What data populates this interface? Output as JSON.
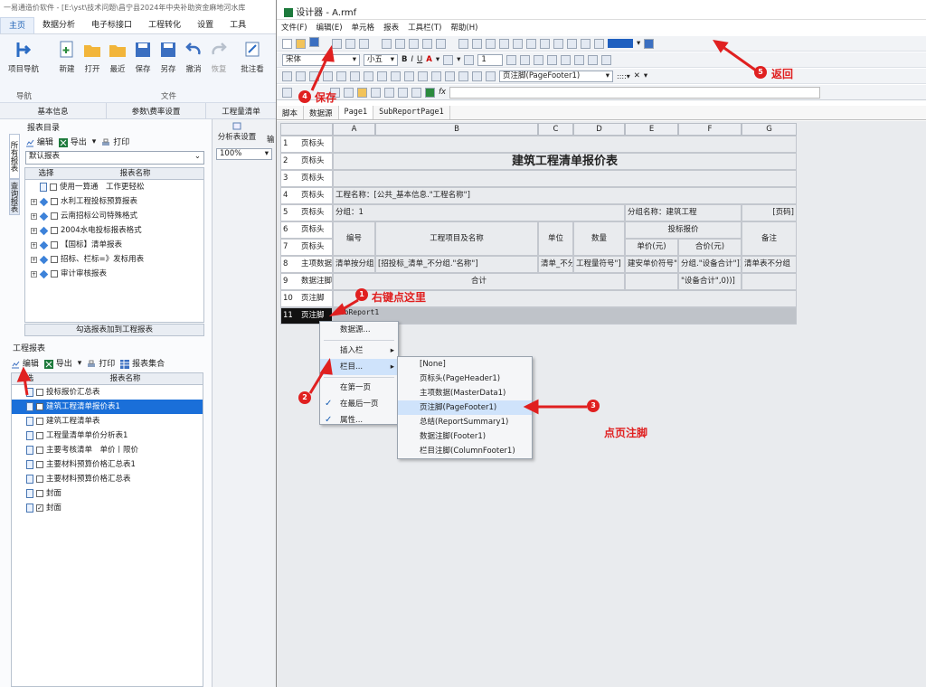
{
  "app": {
    "title": "一易通造价软件 - [E:\\yst\\技术问题\\昌宁县2024年中央补助资金麻地河水库",
    "tabs": [
      "主页",
      "数据分析",
      "电子标接口",
      "工程转化",
      "设置",
      "工具"
    ],
    "ribbon": {
      "nav_button": "项目导航",
      "new": "新建",
      "open": "打开",
      "recent": "最近",
      "save": "保存",
      "saveas": "另存",
      "undo": "撤消",
      "redo": "恢复",
      "batch": "批注看",
      "group_nav": "导航",
      "group_file": "文件"
    },
    "section_tabs": [
      "基本信息",
      "参数\\费率设置",
      "工程量清单"
    ]
  },
  "report_catalog": {
    "title": "报表目录",
    "side_tabs": [
      "所有报表",
      "查询报表"
    ],
    "toolbar": {
      "edit": "编辑",
      "export": "导出",
      "print": "打印"
    },
    "filter_value": "默认报表",
    "header": {
      "select": "选择",
      "name": "报表名称"
    },
    "items": [
      {
        "name": "使用一算通　工作更轻松",
        "type": "doc"
      },
      {
        "name": "水利工程投标预算报表",
        "type": "folder"
      },
      {
        "name": "云南招标公司特殊格式",
        "type": "folder"
      },
      {
        "name": "2004水电投标报表格式",
        "type": "folder"
      },
      {
        "name": "【国标】清单报表",
        "type": "folder"
      },
      {
        "name": "招标、栏标=》发标用表",
        "type": "folder"
      },
      {
        "name": "审计审核报表",
        "type": "folder"
      }
    ],
    "add_button": "勾选报表加到工程报表"
  },
  "project_reports": {
    "title": "工程报表",
    "toolbar": {
      "edit": "编辑",
      "export": "导出",
      "print": "打印",
      "collection": "报表集合"
    },
    "header": {
      "select": "选",
      "name": "报表名称"
    },
    "items": [
      {
        "name": "投标报价汇总表",
        "checked": false,
        "selected": false
      },
      {
        "name": "建筑工程清单报价表1",
        "checked": false,
        "selected": true
      },
      {
        "name": "建筑工程清单表",
        "checked": false,
        "selected": false
      },
      {
        "name": "工程量清单单价分析表1",
        "checked": false,
        "selected": false
      },
      {
        "name": "主要考核清单　单价丨限价",
        "checked": false,
        "selected": false
      },
      {
        "name": "主要材料预算价格汇总表1",
        "checked": false,
        "selected": false
      },
      {
        "name": "主要材料预算价格汇总表",
        "checked": false,
        "selected": false
      },
      {
        "name": "封面",
        "checked": false,
        "selected": false
      },
      {
        "name": "封面",
        "checked": true,
        "selected": false
      }
    ]
  },
  "middle": {
    "analysis_settings": "分析表设置",
    "zoom": "100%",
    "extra": "输"
  },
  "designer": {
    "title": "设计器 - A.rmf",
    "menu": [
      "文件(F)",
      "编辑(E)",
      "单元格",
      "报表",
      "工具栏(T)",
      "帮助(H)"
    ],
    "font": "宋体",
    "font_size": "小五",
    "line_width": "1",
    "band_select": "页注脚(PageFooter1)",
    "sheet_tabs": [
      "脚本",
      "数据源",
      "Page1",
      "SubReportPage1"
    ],
    "columns": [
      "A",
      "B",
      "C",
      "D",
      "E",
      "F",
      "G"
    ],
    "rows": [
      {
        "n": "1",
        "label": "页标头"
      },
      {
        "n": "2",
        "label": "页标头"
      },
      {
        "n": "3",
        "label": "页标头"
      },
      {
        "n": "4",
        "label": "页标头"
      },
      {
        "n": "5",
        "label": "页标头"
      },
      {
        "n": "6",
        "label": "页标头"
      },
      {
        "n": "7",
        "label": "页标头"
      },
      {
        "n": "8",
        "label": "主项数据"
      },
      {
        "n": "9",
        "label": "数据注脚"
      },
      {
        "n": "10",
        "label": "页注脚"
      },
      {
        "n": "11",
        "label": "页注脚"
      }
    ],
    "cells": {
      "report_title": "建筑工程清单报价表",
      "project_name": "工程名称：[公共_基本信息.\"工程名称\"]",
      "group": "分组：1",
      "group_name": "分组名称：建筑工程",
      "page": "[页码]",
      "h_no": "编号",
      "h_item": "工程项目及名称",
      "h_unit": "单位",
      "h_qty": "数量",
      "h_bid": "投标报价",
      "h_price": "单价(元)",
      "h_total": "合价(元)",
      "h_note": "备注",
      "d_a": "清单按分组",
      "d_b": "[招投标_清单_不分组.\"名称\"]",
      "d_c": "清单_不分组",
      "d_d": "工程量符号\"]",
      "d_e": "建安单价符号\"]",
      "d_f": "分组.\"设备合计\"]]",
      "d_g": "清单表不分组",
      "sum": "合计",
      "sum_f": "\"设备合计\",0))]",
      "subreport": "SubReport1"
    }
  },
  "context_menu": {
    "items": [
      "数据源...",
      "插入栏",
      "栏目...",
      "在第一页",
      "在最后一页",
      "属性..."
    ],
    "submenu": [
      "[None]",
      "页标头(PageHeader1)",
      "主项数据(MasterData1)",
      "页注脚(PageFooter1)",
      "总结(ReportSummary1)",
      "数据注脚(Footer1)",
      "栏目注脚(ColumnFooter1)"
    ]
  },
  "annotations": {
    "n1": "1",
    "t1": "右键点这里",
    "n2": "2",
    "n3": "3",
    "t3": "点页注脚",
    "n4": "4",
    "t4": "保存",
    "n5": "5",
    "t5": "返回"
  },
  "colors": {
    "accent": "#1a5fb4",
    "annotation": "#e02020",
    "selection": "#1a6fd9"
  }
}
